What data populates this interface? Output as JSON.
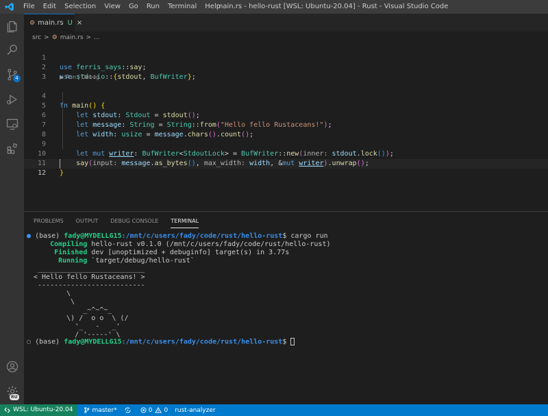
{
  "titlebar": {
    "menu": [
      "File",
      "Edit",
      "Selection",
      "View",
      "Go",
      "Run",
      "Terminal",
      "Help"
    ],
    "title": "main.rs - hello-rust [WSL: Ubuntu-20.04] - Rust - Visual Studio Code"
  },
  "activity": {
    "scm_badge": "4",
    "account_badge": "RU"
  },
  "tab": {
    "filename": "main.rs",
    "modified": "U",
    "close": "×",
    "file_glyph": "⚙"
  },
  "breadcrumb": {
    "folder": "src",
    "sep": ">",
    "file": "main.rs",
    "symbol": "..."
  },
  "editor": {
    "codelens": "▶ Run | Debug",
    "line_numbers": [
      "1",
      "2",
      "3",
      "4",
      "5",
      "6",
      "7",
      "8",
      "9",
      "10",
      "11",
      "12"
    ]
  },
  "panel": {
    "tabs": [
      "PROBLEMS",
      "OUTPUT",
      "DEBUG CONSOLE",
      "TERMINAL"
    ],
    "active_tab": "TERMINAL"
  },
  "terminal": {
    "env": "(base)",
    "user": "fady@MYDELLG15",
    "path": ":/mnt/c/users/fady/code/rust/hello-rust",
    "prompt_char": "$",
    "command": " cargo run",
    "compiling_label": "Compiling",
    "compiling_text": " hello-rust v0.1.0 (/mnt/c/users/fady/code/rust/hello-rust)",
    "finished_label": "Finished",
    "finished_text": " dev [unoptimized + debuginfo] target(s) in 3.77s",
    "running_label": "Running",
    "running_text": " `target/debug/hello-rust`",
    "ascii": [
      " __________________________",
      "< Hello fello Rustaceans! >",
      " --------------------------",
      "        \\",
      "         \\",
      "            _~^~^~_",
      "        \\) /  o o  \\ (/",
      "          '_   -   _'",
      "          / '-----' \\"
    ]
  },
  "statusbar": {
    "remote": "WSL: Ubuntu-20.04",
    "branch": "master*",
    "errors": "0",
    "warnings": "0",
    "analyzer": "rust-analyzer"
  }
}
